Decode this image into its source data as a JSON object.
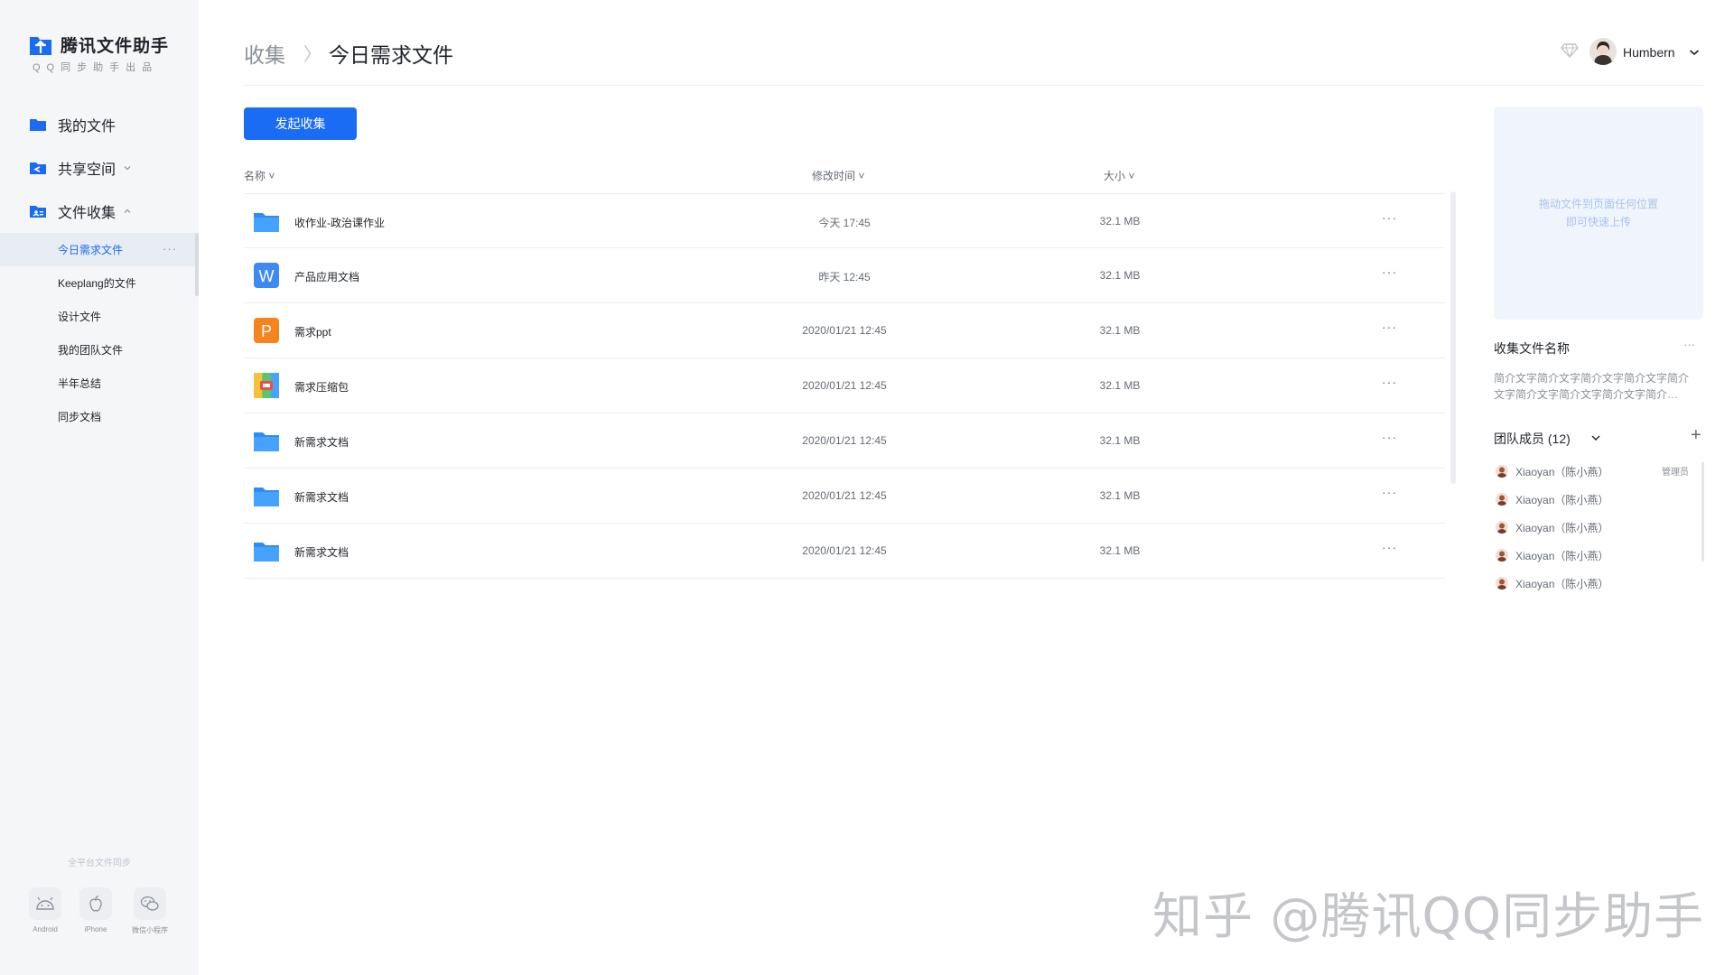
{
  "app": {
    "title": "腾讯文件助手",
    "subtitle": "QQ同步助手出品"
  },
  "sidebar": {
    "items": [
      {
        "label": "我的文件",
        "icon": "folder-icon"
      },
      {
        "label": "共享空间",
        "icon": "share-space-icon",
        "expanded": false
      },
      {
        "label": "文件收集",
        "icon": "collect-icon",
        "expanded": true
      }
    ],
    "sub_items": [
      {
        "label": "今日需求文件",
        "active": true,
        "more": "···"
      },
      {
        "label": "Keeplang的文件"
      },
      {
        "label": "设计文件"
      },
      {
        "label": "我的团队文件"
      },
      {
        "label": "半年总结"
      },
      {
        "label": "同步文档"
      }
    ],
    "sync_caption": "全平台文件同步",
    "platforms": [
      {
        "label": "Android",
        "icon": "android-icon"
      },
      {
        "label": "iPhone",
        "icon": "apple-icon"
      },
      {
        "label": "微信小程序",
        "icon": "wechat-icon"
      }
    ]
  },
  "header": {
    "breadcrumb_root": "收集",
    "breadcrumb_sep": "〉",
    "breadcrumb_current": "今日需求文件",
    "user_name": "Humbern"
  },
  "main": {
    "primary_button": "发起收集",
    "columns": {
      "name": "名称",
      "modified": "修改时间",
      "size": "大小"
    },
    "files": [
      {
        "name": "收作业-政治课作业",
        "modified": "今天 17:45",
        "size": "32.1 MB",
        "type": "folder",
        "more": "···"
      },
      {
        "name": "产品应用文档",
        "modified": "昨天 12:45",
        "size": "32.1 MB",
        "type": "word",
        "more": "···"
      },
      {
        "name": "需求ppt",
        "modified": "2020/01/21 12:45",
        "size": "32.1 MB",
        "type": "ppt",
        "more": "···"
      },
      {
        "name": "需求压缩包",
        "modified": "2020/01/21 12:45",
        "size": "32.1 MB",
        "type": "zip",
        "more": "···"
      },
      {
        "name": "新需求文档",
        "modified": "2020/01/21 12:45",
        "size": "32.1 MB",
        "type": "folder",
        "more": "···"
      },
      {
        "name": "新需求文档",
        "modified": "2020/01/21 12:45",
        "size": "32.1 MB",
        "type": "folder",
        "more": "···"
      },
      {
        "name": "新需求文档",
        "modified": "2020/01/21 12:45",
        "size": "32.1 MB",
        "type": "folder",
        "more": "···"
      }
    ]
  },
  "panel": {
    "dropzone_line1": "拖动文件到页面任何位置",
    "dropzone_line2": "即可快速上传",
    "title": "收集文件名称",
    "more": "···",
    "desc_line1": "简介文字简介文字简介文字简介文字简介",
    "desc_line2": "文字简介文字简介文字简介文字简介…",
    "team_title": "团队成员 (12)",
    "add": "+",
    "members": [
      {
        "name": "Xiaoyan（陈小燕）",
        "role": "管理员"
      },
      {
        "name": "Xiaoyan（陈小燕）"
      },
      {
        "name": "Xiaoyan（陈小燕）"
      },
      {
        "name": "Xiaoyan（陈小燕）"
      },
      {
        "name": "Xiaoyan（陈小燕）"
      }
    ]
  },
  "watermark": "知乎 @腾讯QQ同步助手",
  "colors": {
    "accent": "#1a6cf5",
    "sidebar_bg": "#f5f6f8",
    "active_bg": "#e8ecf3",
    "folder": "#2f8cf6"
  }
}
